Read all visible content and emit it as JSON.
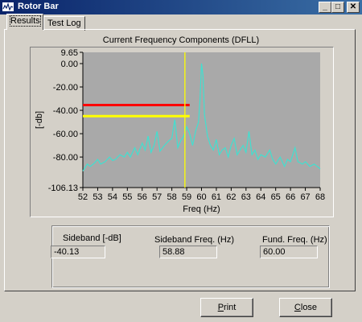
{
  "window": {
    "title": "Rotor Bar",
    "minimize_glyph": "_",
    "maximize_glyph": "□",
    "close_glyph": "✕",
    "icon": "app-icon"
  },
  "tabs": [
    {
      "label": "Results",
      "active": true
    },
    {
      "label": "Test Log",
      "active": false
    }
  ],
  "chart_title": "Current Frequency Components (DFLL)",
  "chart_data": {
    "type": "line",
    "title": "Current Frequency Components (DFLL)",
    "xlabel": "Freq (Hz)",
    "ylabel": "[-db]",
    "xlim": [
      52,
      68
    ],
    "ylim": [
      -106.13,
      9.65
    ],
    "x_ticks": [
      "52",
      "53",
      "54",
      "55",
      "56",
      "57",
      "58",
      "59",
      "60",
      "61",
      "62",
      "63",
      "64",
      "65",
      "66",
      "67",
      "68"
    ],
    "y_ticks": [
      {
        "value": 9.65,
        "label": "9.65"
      },
      {
        "value": 0,
        "label": "0.00"
      },
      {
        "value": -20,
        "label": "-20.00"
      },
      {
        "value": -40,
        "label": "-40.00"
      },
      {
        "value": -60,
        "label": "-60.00"
      },
      {
        "value": -80,
        "label": "-80.00"
      },
      {
        "value": -106.13,
        "label": "-106.13"
      }
    ],
    "grid": false,
    "background": "#a9a9a9",
    "series": [
      {
        "color": "#40e0d0",
        "x": [
          52.0,
          52.3,
          52.5,
          52.8,
          53.0,
          53.2,
          53.5,
          53.8,
          54.0,
          54.2,
          54.5,
          54.8,
          55.0,
          55.2,
          55.5,
          55.7,
          56.0,
          56.2,
          56.4,
          56.6,
          56.8,
          57.0,
          57.2,
          57.5,
          57.8,
          58.0,
          58.2,
          58.4,
          58.6,
          58.8,
          59.0,
          59.2,
          59.4,
          59.6,
          59.8,
          59.9,
          60.0,
          60.1,
          60.2,
          60.4,
          60.6,
          60.8,
          61.0,
          61.2,
          61.4,
          61.6,
          61.8,
          62.0,
          62.2,
          62.4,
          62.6,
          62.8,
          63.0,
          63.2,
          63.4,
          63.6,
          63.8,
          64.0,
          64.3,
          64.6,
          64.8,
          65.0,
          65.3,
          65.6,
          65.8,
          66.0,
          66.3,
          66.5,
          66.8,
          67.0,
          67.3,
          67.6,
          68.0
        ],
        "y": [
          -92,
          -86,
          -88,
          -85,
          -82,
          -86,
          -84,
          -80,
          -83,
          -82,
          -78,
          -80,
          -76,
          -80,
          -72,
          -78,
          -68,
          -74,
          -62,
          -76,
          -70,
          -58,
          -75,
          -70,
          -66,
          -64,
          -48,
          -72,
          -66,
          -62,
          -54,
          -60,
          -70,
          -58,
          -50,
          -30,
          0,
          -10,
          -44,
          -62,
          -70,
          -74,
          -65,
          -78,
          -74,
          -72,
          -80,
          -70,
          -64,
          -78,
          -74,
          -70,
          -76,
          -58,
          -78,
          -74,
          -82,
          -78,
          -80,
          -74,
          -82,
          -86,
          -80,
          -88,
          -82,
          -84,
          -72,
          -84,
          -86,
          -84,
          -88,
          -86,
          -90
        ]
      }
    ],
    "hlines": [
      {
        "y": -35.5,
        "x_start": 52,
        "x_end": 59.2,
        "color": "#ff0000"
      },
      {
        "y": -45,
        "x_start": 52,
        "x_end": 59.2,
        "color": "#ffff00"
      }
    ],
    "vlines": [
      {
        "x": 58.88,
        "color": "#ffff00"
      }
    ]
  },
  "results": {
    "sideband_label": "Sideband [-dB]",
    "sideband_value": "-40.13",
    "sideband_freq_label": "Sideband Freq. (Hz)",
    "sideband_freq_value": "58.88",
    "fund_freq_label": "Fund. Freq. (Hz)",
    "fund_freq_value": "60.00"
  },
  "buttons": {
    "print_prefix": "",
    "print_mnemonic": "P",
    "print_rest": "rint",
    "close_prefix": "",
    "close_mnemonic": "C",
    "close_rest": "lose"
  }
}
